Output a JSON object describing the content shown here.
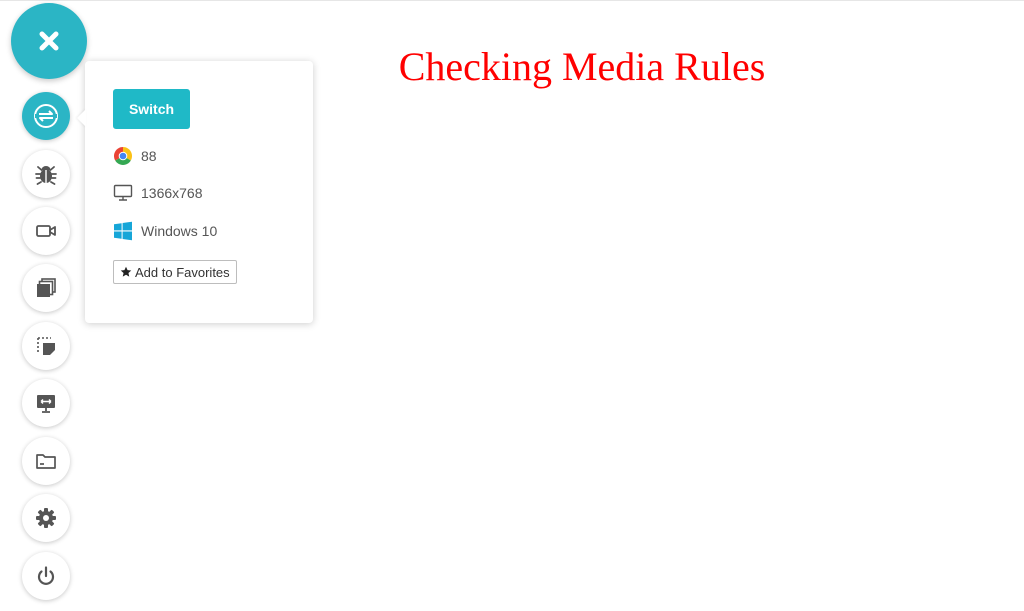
{
  "page": {
    "title": "Checking Media Rules"
  },
  "toolbar": {
    "accent_color": "#2bb5c5",
    "items": [
      {
        "name": "close",
        "icon": "close-icon"
      },
      {
        "name": "switch-browser",
        "icon": "switch-icon",
        "active": true
      },
      {
        "name": "debug",
        "icon": "bug-icon"
      },
      {
        "name": "record-video",
        "icon": "video-camera-icon"
      },
      {
        "name": "screenshots",
        "icon": "gallery-icon"
      },
      {
        "name": "capture-region",
        "icon": "region-capture-icon"
      },
      {
        "name": "resolution",
        "icon": "monitor-resize-icon"
      },
      {
        "name": "files",
        "icon": "folder-icon"
      },
      {
        "name": "settings",
        "icon": "gear-icon"
      },
      {
        "name": "end-session",
        "icon": "power-icon"
      }
    ]
  },
  "popover": {
    "switch_label": "Switch",
    "browser_version": "88",
    "browser_icon": "chrome-icon",
    "resolution": "1366x768",
    "resolution_icon": "monitor-icon",
    "os": "Windows 10",
    "os_icon": "windows-icon",
    "favorites_label": "Add to Favorites",
    "favorites_icon": "star-icon"
  }
}
